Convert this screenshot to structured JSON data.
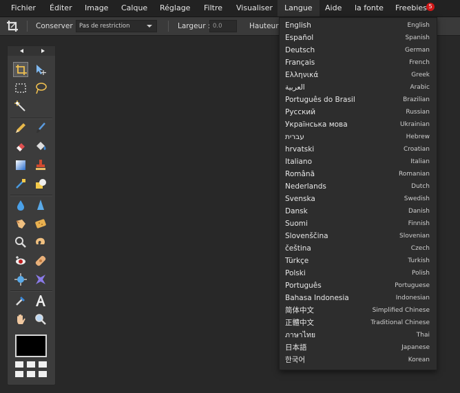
{
  "menu": {
    "items": [
      "Fichier",
      "Éditer",
      "Image",
      "Calque",
      "Réglage",
      "Filtre",
      "Visualiser",
      "Langue",
      "Aide",
      "la fonte",
      "Freebies"
    ],
    "freebies_badge": "5",
    "active": "Langue"
  },
  "options": {
    "keep_label": "Conserver :",
    "keep_value": "Pas de restriction",
    "width_label": "Largeur :",
    "width_value": "0.0",
    "height_label": "Hauteur"
  },
  "toolbox": {
    "foreground_color": "#000000",
    "tools": [
      "crop-icon",
      "move-icon",
      "rect-select-icon",
      "lasso-icon",
      "magic-wand-icon",
      "pencil-icon",
      "brush-icon",
      "eraser-icon",
      "bucket-icon",
      "gradient-icon",
      "clone-stamp-icon",
      "color-replace-icon",
      "shape-icon",
      "blur-icon",
      "sharpen-icon",
      "smudge-icon",
      "sponge-icon",
      "dodge-icon",
      "burn-icon",
      "red-eye-icon",
      "spot-heal-icon",
      "bloat-icon",
      "pinch-icon",
      "color-picker-icon",
      "type-icon",
      "hand-icon",
      "zoom-icon"
    ]
  },
  "languages": [
    {
      "native": "English",
      "english": "English"
    },
    {
      "native": "Español",
      "english": "Spanish"
    },
    {
      "native": "Deutsch",
      "english": "German"
    },
    {
      "native": "Français",
      "english": "French"
    },
    {
      "native": "Ελληνικά",
      "english": "Greek"
    },
    {
      "native": "العربية",
      "english": "Arabic"
    },
    {
      "native": "Português do Brasil",
      "english": "Brazilian"
    },
    {
      "native": "Русский",
      "english": "Russian"
    },
    {
      "native": "Українська мова",
      "english": "Ukrainian"
    },
    {
      "native": "עברית",
      "english": "Hebrew"
    },
    {
      "native": "hrvatski",
      "english": "Croatian"
    },
    {
      "native": "Italiano",
      "english": "Italian"
    },
    {
      "native": "Română",
      "english": "Romanian"
    },
    {
      "native": "Nederlands",
      "english": "Dutch"
    },
    {
      "native": "Svenska",
      "english": "Swedish"
    },
    {
      "native": "Dansk",
      "english": "Danish"
    },
    {
      "native": "Suomi",
      "english": "Finnish"
    },
    {
      "native": "Slovenščina",
      "english": "Slovenian"
    },
    {
      "native": "čeština",
      "english": "Czech"
    },
    {
      "native": "Türkçe",
      "english": "Turkish"
    },
    {
      "native": "Polski",
      "english": "Polish"
    },
    {
      "native": "Português",
      "english": "Portuguese"
    },
    {
      "native": "Bahasa Indonesia",
      "english": "Indonesian"
    },
    {
      "native": "简体中文",
      "english": "Simplified Chinese"
    },
    {
      "native": "正體中文",
      "english": "Traditional Chinese"
    },
    {
      "native": "ภาษาไทย",
      "english": "Thai"
    },
    {
      "native": "日本語",
      "english": "Japanese"
    },
    {
      "native": "한국어",
      "english": "Korean"
    }
  ]
}
